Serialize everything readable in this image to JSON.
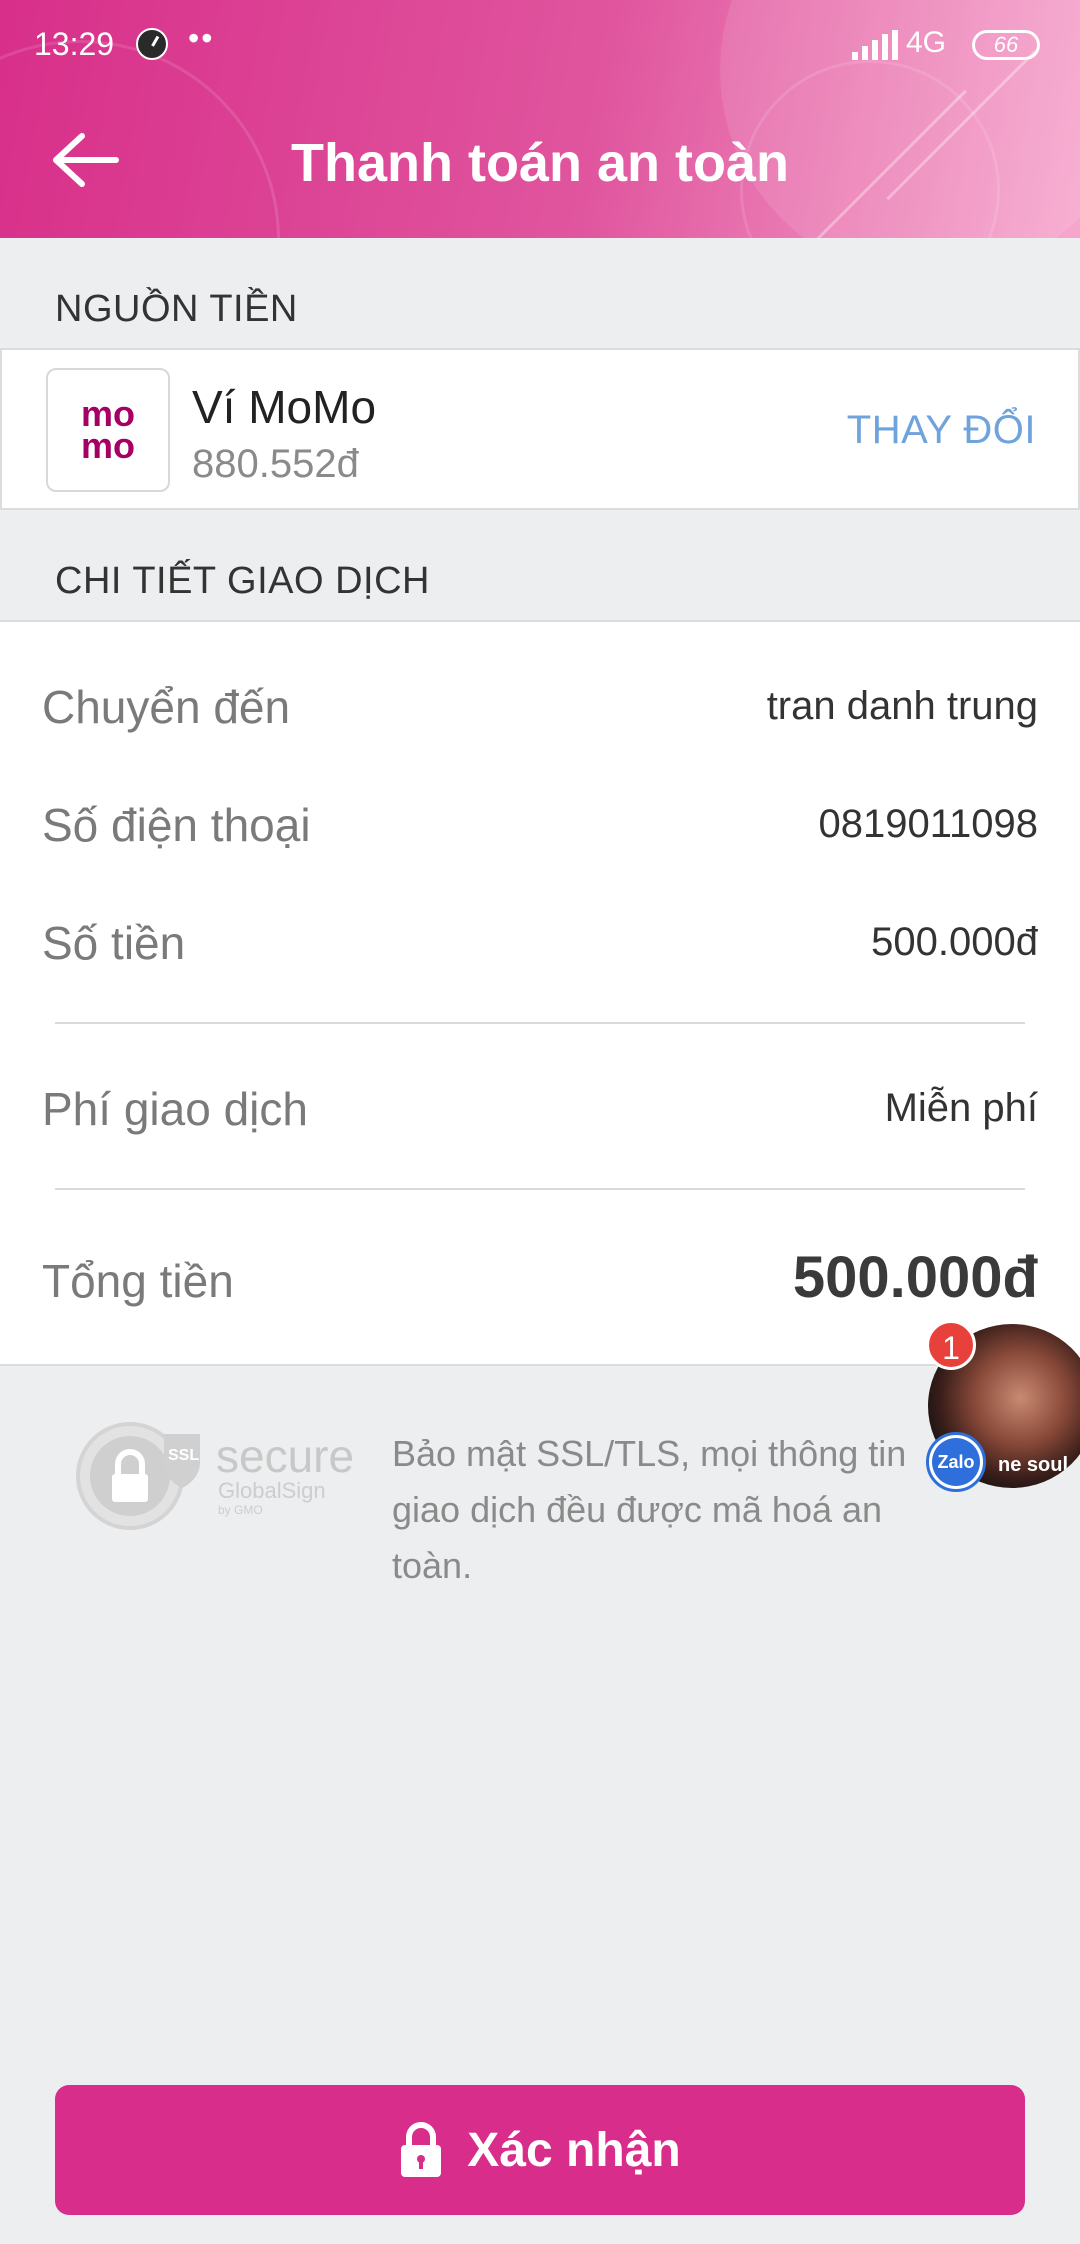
{
  "status_bar": {
    "time": "13:29",
    "dots": "••",
    "network": "4G",
    "battery": "66"
  },
  "header": {
    "title": "Thanh toán an toàn",
    "back_icon": "arrow-left-icon"
  },
  "source": {
    "section_label": "NGUỒN TIỀN",
    "logo_line1": "mo",
    "logo_line2": "mo",
    "wallet_name": "Ví MoMo",
    "balance": "880.552đ",
    "change_label": "THAY ĐỔI"
  },
  "details": {
    "section_label": "CHI TIẾT GIAO DỊCH",
    "rows": [
      {
        "label": "Chuyển đến",
        "value": "tran danh trung"
      },
      {
        "label": "Số điện thoại",
        "value": "0819011098"
      },
      {
        "label": "Số tiền",
        "value": "500.000đ"
      },
      {
        "label": "Phí giao dịch",
        "value": "Miễn phí"
      },
      {
        "label": "Tổng tiền",
        "value": "500.000đ"
      }
    ]
  },
  "security": {
    "logo_ssl": "SSL",
    "logo_secure": "secure",
    "logo_globalsign": "GlobalSign",
    "logo_gmo": "by GMO",
    "text": "Bảo mật SSL/TLS, mọi thông tin giao dịch đều được mã hoá an toàn."
  },
  "chat_head": {
    "badge": "1",
    "app": "Zalo",
    "caption": "ne soul"
  },
  "confirm": {
    "label": "Xác nhận"
  },
  "colors": {
    "brand_pink": "#d82d8b",
    "momo_purple": "#a50064",
    "link_blue": "#6fa3dc"
  }
}
